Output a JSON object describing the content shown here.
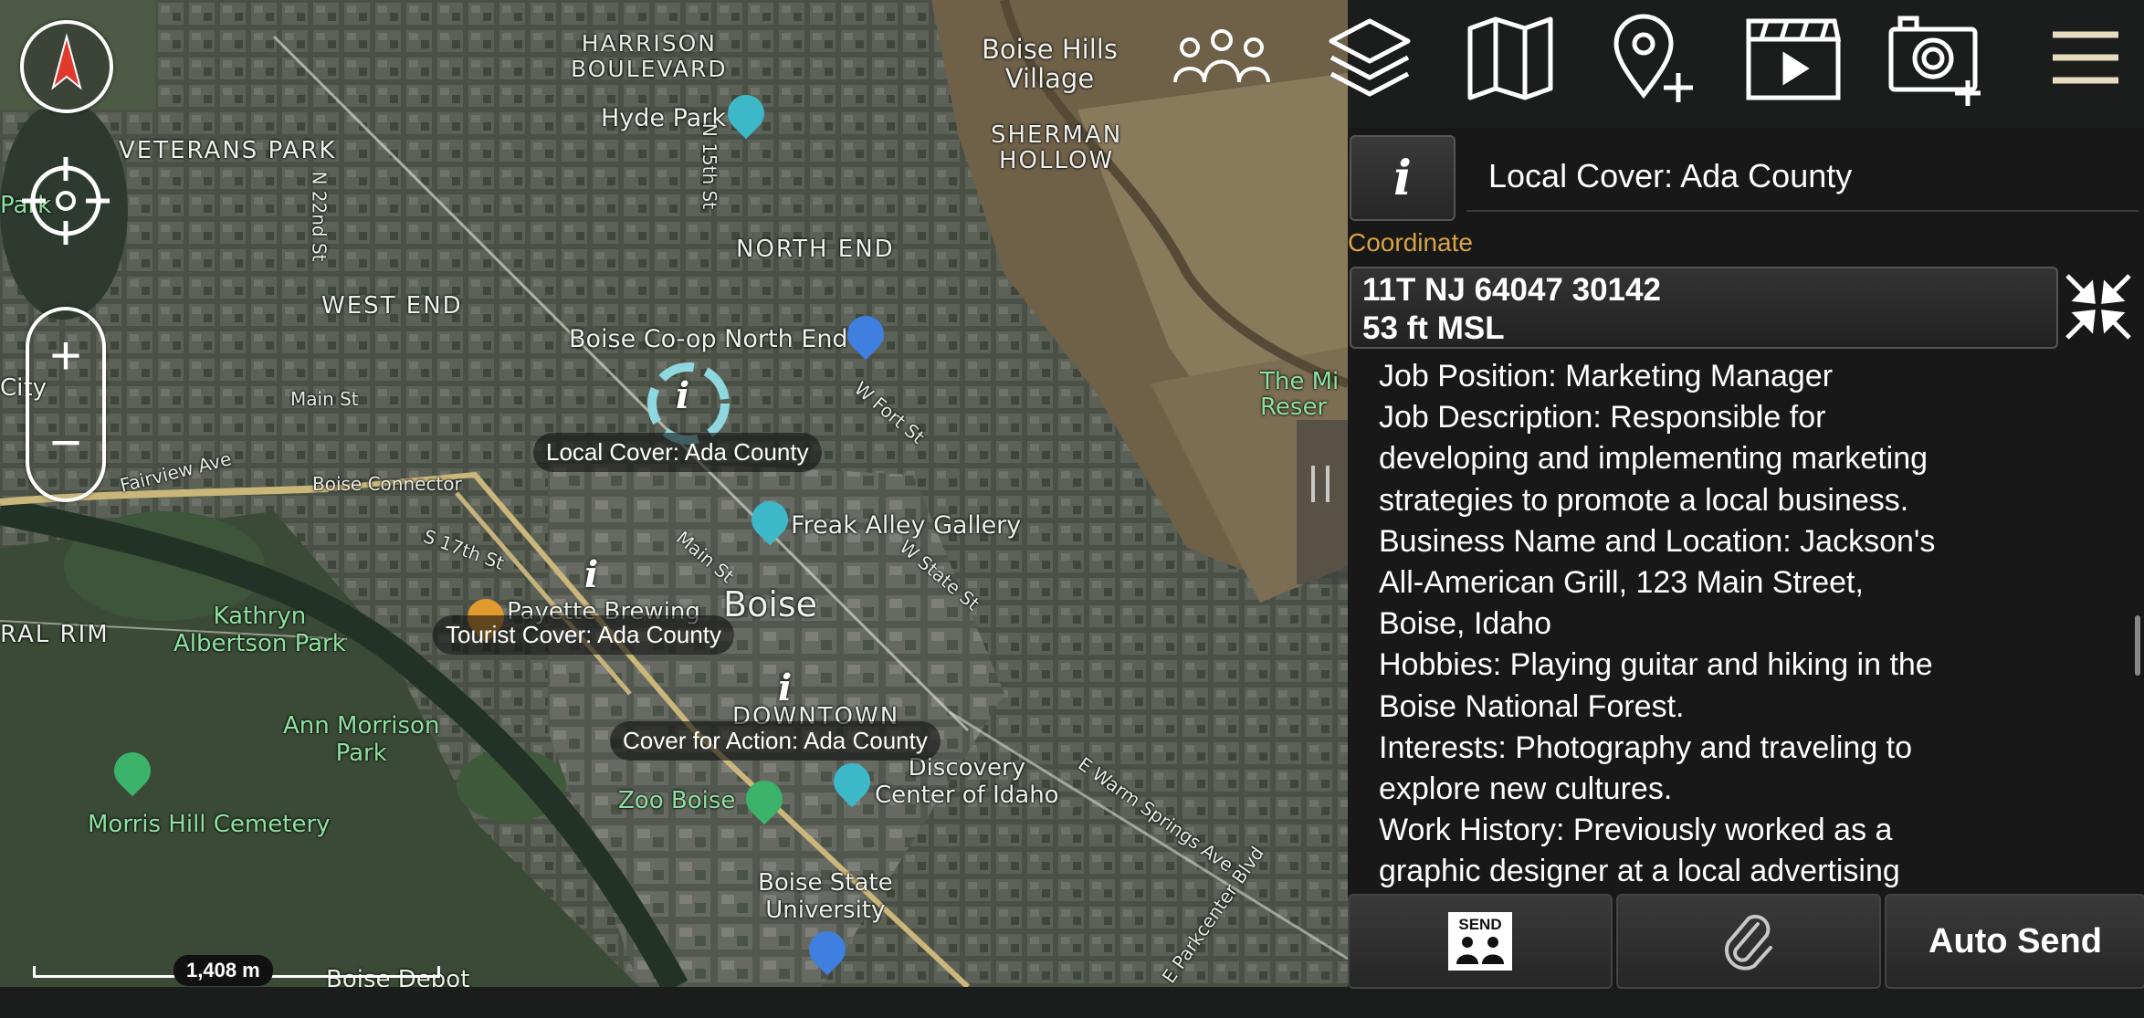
{
  "map": {
    "labels": {
      "harrison": "HARRISON\nBOULEVARD",
      "boise_hills": "Boise Hills\nVillage",
      "veterans": "VETERANS PARK",
      "hyde_park": "Hyde Park",
      "sherman": "SHERMAN\nHOLLOW",
      "north_end": "NORTH END",
      "west_end": "WEST END",
      "coop": "Boise Co-op North End",
      "main_st": "Main St",
      "fort_st": "W Fort St",
      "fairview": "Fairview Ave",
      "connector": "Boise Connector",
      "freak_alley": "Freak Alley Gallery",
      "state_st": "W State St",
      "main_st_2": "Main St",
      "st17": "S 17th St",
      "boise": "Boise",
      "payette": "Payette Brewing",
      "rim": "RAL RIM",
      "kathryn": "Kathryn\nAlbertson Park",
      "downtown": "DOWNTOWN",
      "ann_morrison": "Ann Morrison\nPark",
      "discovery": "Discovery\nCenter of Idaho",
      "warm_springs": "E Warm Springs Ave",
      "zoo": "Zoo Boise",
      "morris": "Morris Hill Cemetery",
      "bsu": "Boise State\nUniversity",
      "depot": "Boise Depot",
      "the_mi": "The Mi\nReser",
      "parkcenter": "E Parkcenter Blvd",
      "n22": "N 22nd St",
      "n15": "N 15th St",
      "city": "City",
      "park": "Park"
    },
    "markers": [
      {
        "label": "Local Cover: Ada County"
      },
      {
        "label": "Tourist Cover: Ada County"
      },
      {
        "label": "Cover for Action: Ada County"
      }
    ],
    "scale": "1,408 m"
  },
  "toolbar": {
    "icons": [
      "team-icon",
      "layers-icon",
      "map-icon",
      "add-point-icon",
      "video-icon",
      "add-photo-icon",
      "menu-icon"
    ]
  },
  "panel": {
    "info_glyph": "i",
    "title": "Local Cover: Ada County",
    "coordinate_label": "Coordinate",
    "coordinate": "11T NJ 64047 30142",
    "altitude": "53 ft MSL",
    "remarks": [
      "Job Position: Marketing Manager",
      "Job Description: Responsible for",
      "developing and implementing marketing",
      "strategies to promote a local business.",
      "Business Name and Location: Jackson's",
      "All-American Grill, 123 Main Street,",
      "Boise, Idaho",
      "Hobbies: Playing guitar and hiking in the",
      "Boise National Forest.",
      "Interests: Photography and traveling to",
      "explore new cultures.",
      "Work History: Previously worked as a",
      "graphic designer at a local advertising"
    ],
    "send_icon_text": "SEND",
    "auto_send": "Auto Send"
  },
  "colors": {
    "coordinate_label": "#d9a441",
    "marker_accent": "#8fd8e0",
    "panel_bg": "#181818"
  }
}
